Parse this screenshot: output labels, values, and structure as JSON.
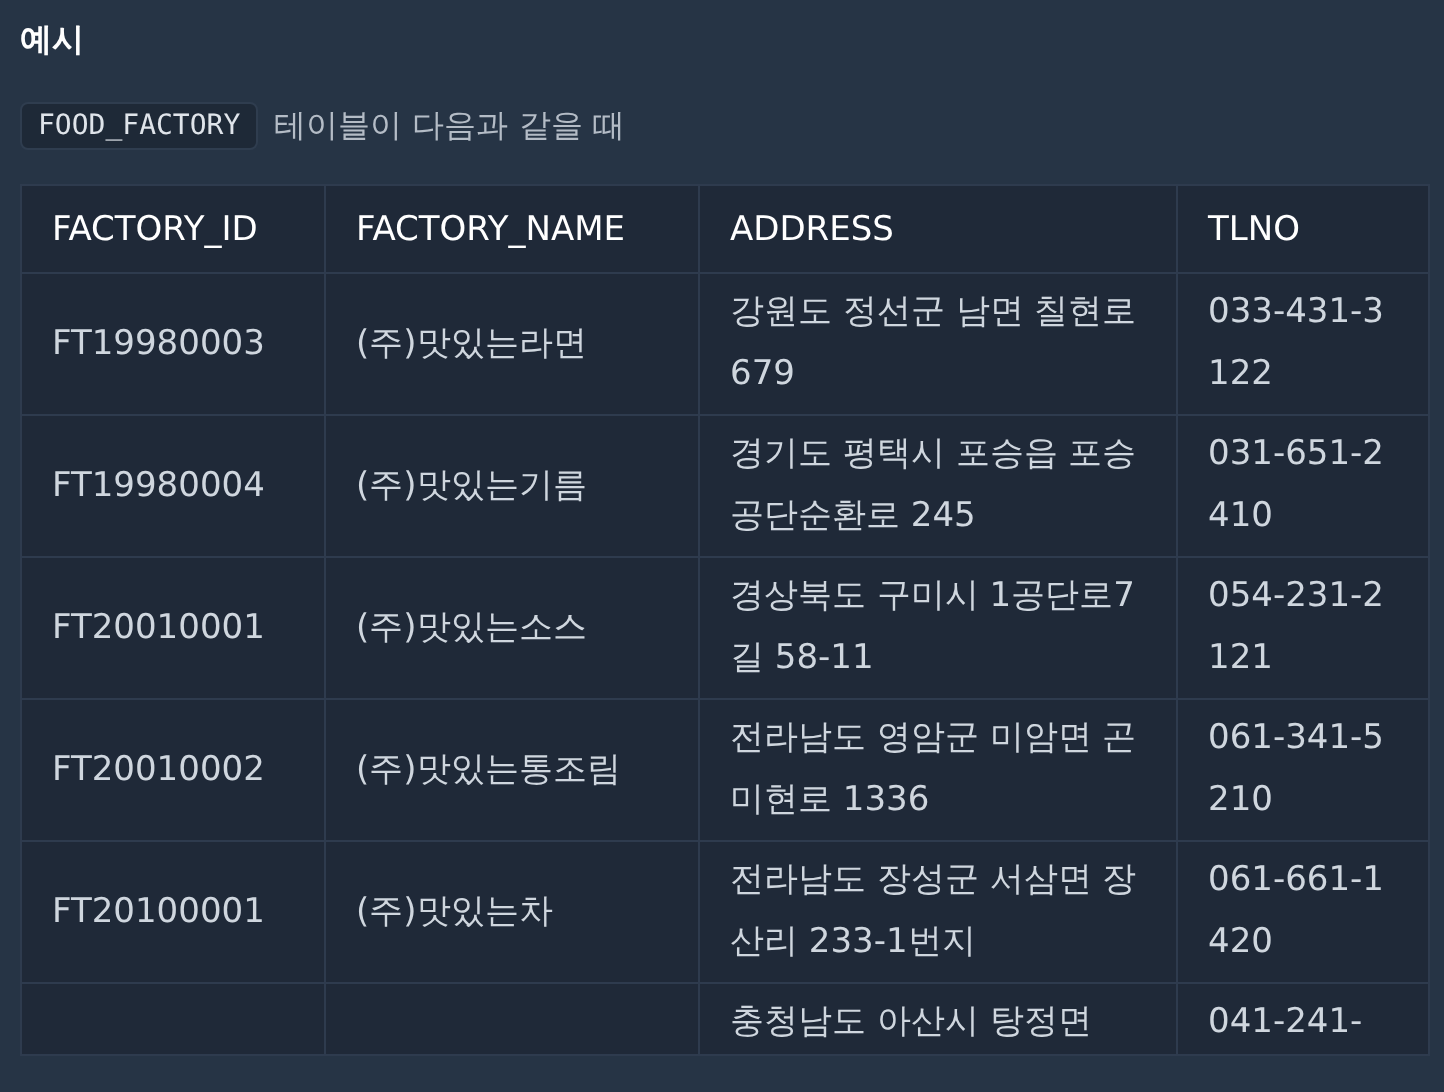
{
  "heading": "예시",
  "intro": {
    "code": "FOOD_FACTORY",
    "text": "테이블이 다음과 같을 때"
  },
  "table": {
    "columns": [
      "FACTORY_ID",
      "FACTORY_NAME",
      "ADDRESS",
      "TLNO"
    ],
    "rows": [
      {
        "factory_id": "FT19980003",
        "factory_name": "(주)맛있는라면",
        "address": "강원도 정선군 남면 칠현로 679",
        "tlno": "033-431-3122"
      },
      {
        "factory_id": "FT19980004",
        "factory_name": "(주)맛있는기름",
        "address": "경기도 평택시 포승읍 포승공단순환로 245",
        "tlno": "031-651-2410"
      },
      {
        "factory_id": "FT20010001",
        "factory_name": "(주)맛있는소스",
        "address": "경상북도 구미시 1공단로7길 58-11",
        "tlno": "054-231-2121"
      },
      {
        "factory_id": "FT20010002",
        "factory_name": "(주)맛있는통조림",
        "address": "전라남도 영암군 미암면 곤미현로 1336",
        "tlno": "061-341-5210"
      },
      {
        "factory_id": "FT20100001",
        "factory_name": "(주)맛있는차",
        "address": "전라남도 장성군 서삼면 장산리 233-1번지",
        "tlno": "061-661-1420"
      },
      {
        "address": "충청남도 아산시 탕정면",
        "tlno": "041-241-"
      }
    ]
  }
}
